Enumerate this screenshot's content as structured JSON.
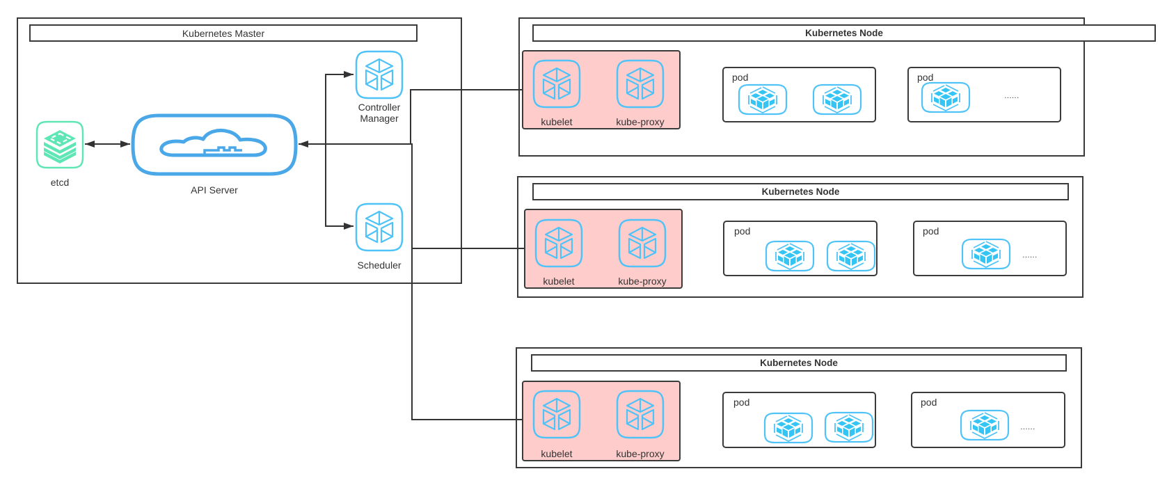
{
  "master": {
    "title": "Kubernetes Master",
    "etcd": {
      "label": "etcd"
    },
    "api_server": {
      "label": "API Server"
    },
    "controller_manager": {
      "label_line1": "Controller",
      "label_line2": "Manager"
    },
    "scheduler": {
      "label": "Scheduler"
    }
  },
  "nodes": [
    {
      "title": "Kubernetes Node",
      "agents": {
        "kubelet": "kubelet",
        "kube_proxy": "kube-proxy"
      },
      "pods": [
        {
          "label": "pod",
          "containers": 2
        },
        {
          "label": "pod",
          "containers": 1,
          "more": "......"
        }
      ]
    },
    {
      "title": "Kubernetes Node",
      "agents": {
        "kubelet": "kubelet",
        "kube_proxy": "kube-proxy"
      },
      "pods": [
        {
          "label": "pod",
          "containers": 2
        },
        {
          "label": "pod",
          "containers": 1,
          "more": "......"
        }
      ]
    },
    {
      "title": "Kubernetes Node",
      "agents": {
        "kubelet": "kubelet",
        "kube_proxy": "kube-proxy"
      },
      "pods": [
        {
          "label": "pod",
          "containers": 2
        },
        {
          "label": "pod",
          "containers": 1,
          "more": "......"
        }
      ]
    }
  ],
  "edges": [
    {
      "from": "etcd",
      "to": "API Server",
      "arrows": "both"
    },
    {
      "from": "API Server",
      "to": "Controller Manager",
      "arrows": "end"
    },
    {
      "from": "API Server",
      "to": "Scheduler",
      "arrows": "end"
    },
    {
      "from": "Kubernetes Node 1 (kubelet/kube-proxy)",
      "to": "API Server",
      "arrows": "end"
    },
    {
      "from": "Kubernetes Node 2 (kubelet/kube-proxy)",
      "to": "API Server",
      "arrows": "end"
    },
    {
      "from": "Kubernetes Node 3 (kubelet/kube-proxy)",
      "to": "API Server",
      "arrows": "end"
    }
  ],
  "colors": {
    "icon_blue": "#4FC3F7",
    "api_blue": "#4AA8E8",
    "etcd_green": "#5EE6B4",
    "agent_fill": "#FFCCCC",
    "line": "#333333"
  }
}
